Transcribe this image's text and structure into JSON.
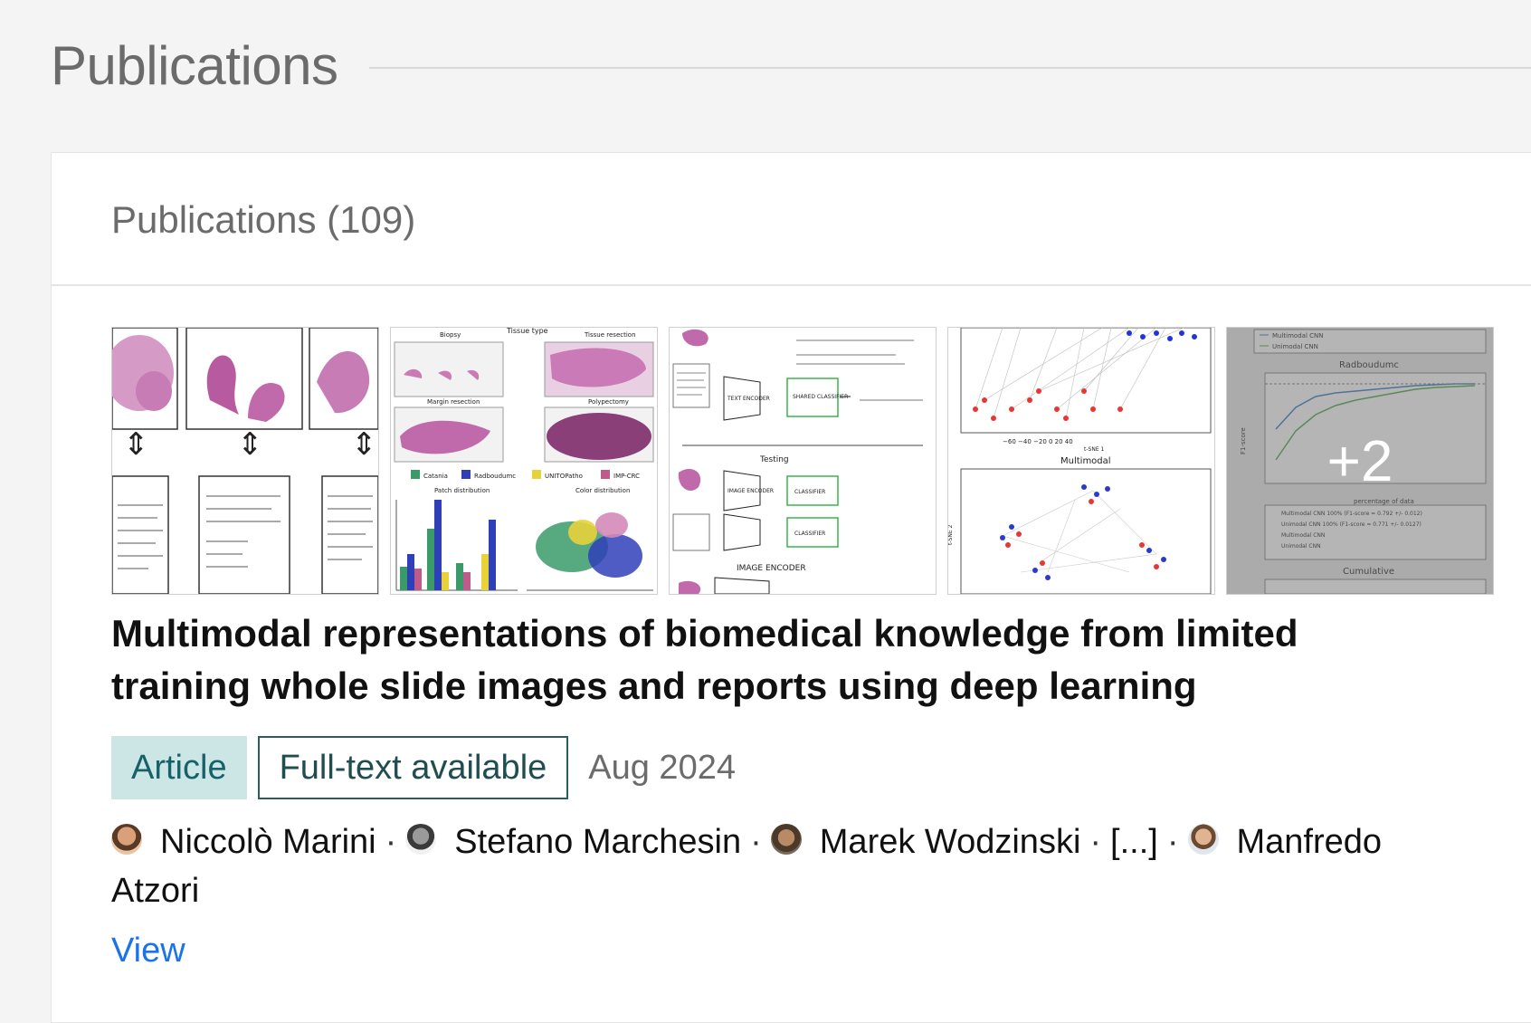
{
  "section": {
    "title": "Publications"
  },
  "card": {
    "title": "Publications (109)"
  },
  "publication": {
    "title": "Multimodal representations of biomedical knowledge from limited training whole slide images and reports using deep learning",
    "type_label": "Article",
    "availability_label": "Full-text available",
    "date": "Aug 2024",
    "authors": [
      {
        "name": "Niccolò Marini",
        "avatar": "avatar-1"
      },
      {
        "name": "Stefano Marchesin",
        "avatar": "avatar-2"
      },
      {
        "name": "Marek Wodzinski",
        "avatar": "avatar-3"
      },
      {
        "name": "[...]",
        "avatar": null
      },
      {
        "name": "Manfredo Atzori",
        "avatar": "avatar-4"
      }
    ],
    "separator": "·",
    "view_label": "View",
    "more_figures_label": "+2",
    "figure_texts": {
      "fig2": {
        "tissue_type": "Tissue type",
        "biopsy": "Biopsy",
        "tissue_resection": "Tissue resection",
        "margin_resection": "Margin resection",
        "polypectomy": "Polypectomy",
        "legend": [
          "Catania",
          "Radboudumc",
          "UNITOPatho",
          "IMP-CRC"
        ],
        "patch_distribution": "Patch distribution",
        "color_distribution": "Color distribution"
      },
      "fig3": {
        "text_encoder": "TEXT ENCODER",
        "shared_classifier": "SHARED CLASSIFIER",
        "testing": "Testing",
        "image_encoder_small": "IMAGE ENCODER",
        "classifier": "CLASSIFIER",
        "image_encoder": "IMAGE ENCODER"
      },
      "fig4": {
        "multimodal": "Multimodal",
        "tsne1": "t-SNE 1",
        "tsne2": "t-SNE 2"
      },
      "fig5": {
        "legend": [
          "Multimodal CNN",
          "Unimodal CNN"
        ],
        "radboudumc": "Radboudumc",
        "xlabel": "percentage of data",
        "ylabel": "F1-score",
        "legend2": [
          "Multimodal CNN 100% (F1-score = 0.792 +/- 0.012)",
          "Unimodal CNN 100% (F1-score = 0.771 +/- 0.0127)",
          "Multimodal CNN",
          "Unimodal CNN"
        ],
        "cumulative": "Cumulative"
      }
    }
  },
  "colors": {
    "accent_link": "#1a73e8",
    "tag_bg": "#cce6e5",
    "tag_text": "#17616a"
  }
}
